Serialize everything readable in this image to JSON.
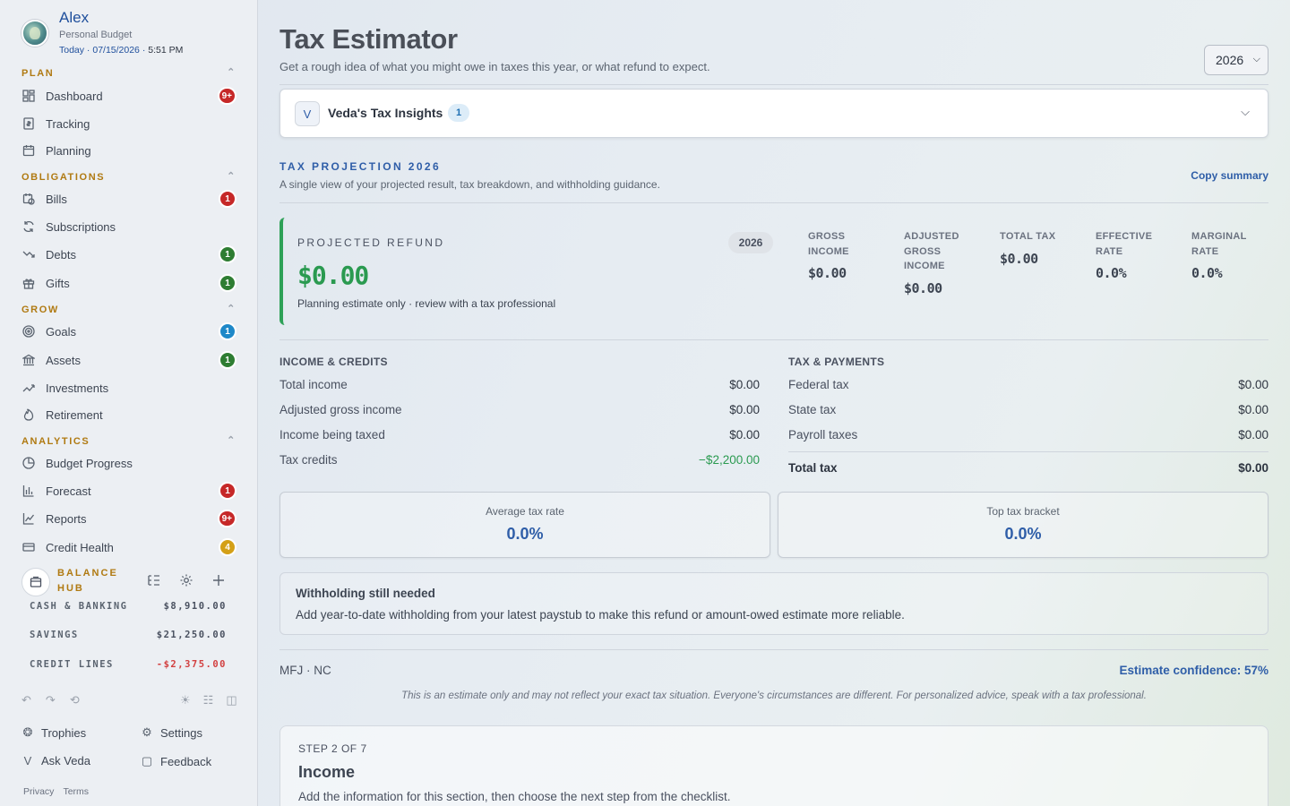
{
  "profile": {
    "name": "Alex",
    "subtitle": "Personal Budget",
    "date_prefix": "Today · 07/15/2026 · ",
    "time": "5:51 PM"
  },
  "sidebar": {
    "sections": [
      {
        "title": "PLAN",
        "items": [
          {
            "label": "Dashboard",
            "icon": "dashboard-icon",
            "badge": "9+",
            "badge_color": "#c62828"
          },
          {
            "label": "Tracking",
            "icon": "receipt-icon"
          },
          {
            "label": "Planning",
            "icon": "calendar-icon"
          }
        ]
      },
      {
        "title": "OBLIGATIONS",
        "items": [
          {
            "label": "Bills",
            "icon": "calendar-clock-icon",
            "badge": "1",
            "badge_color": "#c62828"
          },
          {
            "label": "Subscriptions",
            "icon": "refresh-icon"
          },
          {
            "label": "Debts",
            "icon": "trending-down-icon",
            "badge": "1",
            "badge_color": "#2e7d32"
          },
          {
            "label": "Gifts",
            "icon": "gift-icon",
            "badge": "1",
            "badge_color": "#2e7d32"
          }
        ]
      },
      {
        "title": "GROW",
        "items": [
          {
            "label": "Goals",
            "icon": "target-icon",
            "badge": "1",
            "badge_color": "#1e88c8"
          },
          {
            "label": "Assets",
            "icon": "bank-icon",
            "badge": "1",
            "badge_color": "#2e7d32"
          },
          {
            "label": "Investments",
            "icon": "trending-up-icon"
          },
          {
            "label": "Retirement",
            "icon": "flame-icon"
          }
        ]
      },
      {
        "title": "ANALYTICS",
        "items": [
          {
            "label": "Budget Progress",
            "icon": "pie-chart-icon"
          },
          {
            "label": "Forecast",
            "icon": "bar-chart-icon",
            "badge": "1",
            "badge_color": "#c62828"
          },
          {
            "label": "Reports",
            "icon": "line-chart-icon",
            "badge": "9+",
            "badge_color": "#c62828"
          },
          {
            "label": "Credit Health",
            "icon": "credit-card-icon",
            "badge": "4",
            "badge_color": "#d4a017"
          }
        ]
      }
    ],
    "balance_hub": {
      "title": "BALANCE HUB",
      "rows": [
        {
          "label": "CASH & BANKING",
          "value": "$8,910.00"
        },
        {
          "label": "SAVINGS",
          "value": "$21,250.00"
        },
        {
          "label": "CREDIT LINES",
          "value": "-$2,375.00"
        }
      ]
    },
    "footer": {
      "trophies": "Trophies",
      "settings": "Settings",
      "ask_veda": "Ask Veda",
      "feedback": "Feedback",
      "privacy": "Privacy",
      "terms": "Terms"
    }
  },
  "main": {
    "title": "Tax Estimator",
    "subtitle": "Get a rough idea of what you might owe in taxes this year, or what refund to expect.",
    "year_select": "2026",
    "insights": {
      "logo": "V",
      "title": "Veda's Tax Insights",
      "count": "1"
    },
    "projection": {
      "heading": "TAX PROJECTION 2026",
      "subtitle": "A single view of your projected result, tax breakdown, and withholding guidance.",
      "copy_label": "Copy summary",
      "refund_label": "PROJECTED REFUND",
      "refund_year": "2026",
      "refund_amount": "$0.00",
      "refund_note": "Planning estimate only · review with a tax professional",
      "stats": [
        {
          "label": "GROSS INCOME",
          "value": "$0.00"
        },
        {
          "label": "ADJUSTED GROSS INCOME",
          "value": "$0.00"
        },
        {
          "label": "TOTAL TAX",
          "value": "$0.00"
        },
        {
          "label": "EFFECTIVE RATE",
          "value": "0.0%"
        },
        {
          "label": "MARGINAL RATE",
          "value": "0.0%"
        }
      ]
    },
    "income_credits": {
      "heading": "INCOME & CREDITS",
      "rows": [
        {
          "label": "Total income",
          "value": "$0.00"
        },
        {
          "label": "Adjusted gross income",
          "value": "$0.00"
        },
        {
          "label": "Income being taxed",
          "value": "$0.00"
        },
        {
          "label": "Tax credits",
          "value": "−$2,200.00"
        }
      ]
    },
    "tax_payments": {
      "heading": "TAX & PAYMENTS",
      "rows": [
        {
          "label": "Federal tax",
          "value": "$0.00"
        },
        {
          "label": "State tax",
          "value": "$0.00"
        },
        {
          "label": "Payroll taxes",
          "value": "$0.00"
        }
      ],
      "total_label": "Total tax",
      "total_value": "$0.00"
    },
    "rates": {
      "average_label": "Average tax rate",
      "average_value": "0.0%",
      "top_label": "Top tax bracket",
      "top_value": "0.0%"
    },
    "withholding": {
      "title": "Withholding still needed",
      "body": "Add year-to-date withholding from your latest paystub to make this refund or amount-owed estimate more reliable."
    },
    "filing": "MFJ · NC",
    "confidence": "Estimate confidence: 57%",
    "disclaimer": "This is an estimate only and may not reflect your exact tax situation. Everyone's circumstances are different. For personalized advice, speak with a tax professional.",
    "step": {
      "number": "STEP 2 OF 7",
      "title": "Income",
      "description": "Add the information for this section, then choose the next step from the checklist."
    }
  }
}
